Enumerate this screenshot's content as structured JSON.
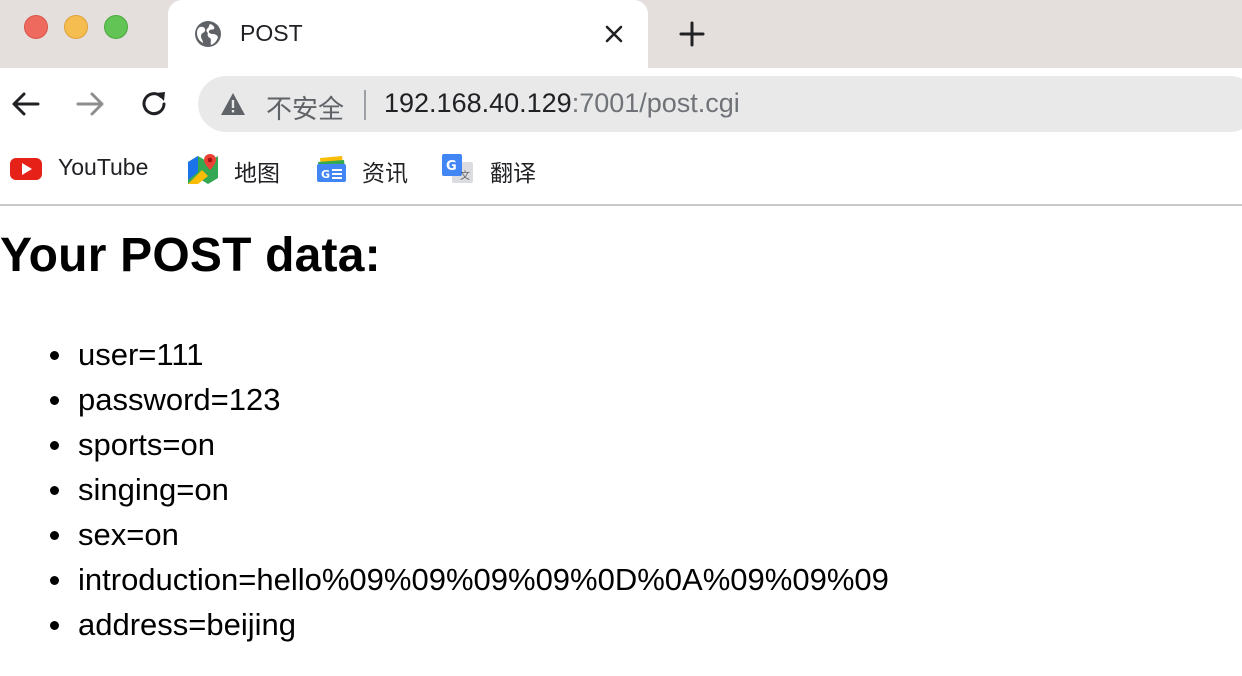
{
  "window": {
    "tab": {
      "title": "POST",
      "icon": "globe-icon"
    },
    "new_tab_icon": "plus-icon"
  },
  "toolbar": {
    "back_icon": "arrow-left-icon",
    "forward_icon": "arrow-right-icon",
    "reload_icon": "reload-icon",
    "security_icon": "warning-triangle-icon",
    "security_label": "不安全",
    "url_host": "192.168.40.129",
    "url_rest": ":7001/post.cgi"
  },
  "bookmarks": [
    {
      "label": "YouTube",
      "icon": "youtube-icon"
    },
    {
      "label": "地图",
      "icon": "maps-icon"
    },
    {
      "label": "资讯",
      "icon": "news-icon"
    },
    {
      "label": "翻译",
      "icon": "translate-icon"
    }
  ],
  "page": {
    "heading": "Your POST data:",
    "items": [
      "user=111",
      "password=123",
      "sports=on",
      "singing=on",
      "sex=on",
      "introduction=hello%09%09%09%09%0D%0A%09%09%09",
      "address=beijing"
    ]
  },
  "colors": {
    "tabstrip": "#e4dfdc",
    "omnibox": "#e9e9e9",
    "close_light": "#ee6a5f",
    "minimize_light": "#f5bd4f",
    "maximize_light": "#61c454"
  }
}
